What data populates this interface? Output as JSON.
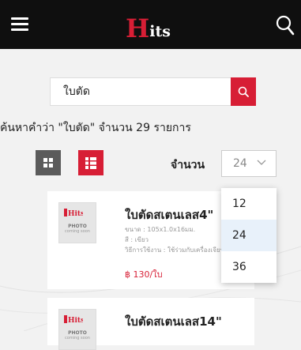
{
  "header": {
    "logo_text": "Hits",
    "icons": {
      "menu": "hamburger-menu-icon",
      "search": "search-icon"
    },
    "colors": {
      "bar": "#0f0f0f",
      "brand": "#d71e35"
    }
  },
  "search": {
    "value": "ใบตัด",
    "placeholder": "",
    "result_summary": "ค้นหาคำว่า \"ใบตัด\" จำนวน 29 รายการ"
  },
  "view_controls": {
    "grid_icon": "grid-view-icon",
    "list_icon": "list-view-icon",
    "active": "list"
  },
  "per_page": {
    "label": "จำนวน",
    "selected": "24",
    "options": [
      "12",
      "24",
      "36"
    ]
  },
  "products": [
    {
      "title": "ใบตัดสเตนเลส4\"",
      "size": "ขนาด : 105x1.0x16มม.",
      "color": "สี : เขียว",
      "usage": "วิธีการใช้งาน : ใช้ร่วมกับเครื่องเจียร",
      "price": "฿ 130/ใบ",
      "thumb_brand": "Hits",
      "thumb_photo": "PHOTO",
      "thumb_coming": "coming soon"
    },
    {
      "title": "ใบตัดสเตนเลส14\"",
      "thumb_brand": "Hits",
      "thumb_photo": "PHOTO",
      "thumb_coming": "coming soon"
    }
  ]
}
